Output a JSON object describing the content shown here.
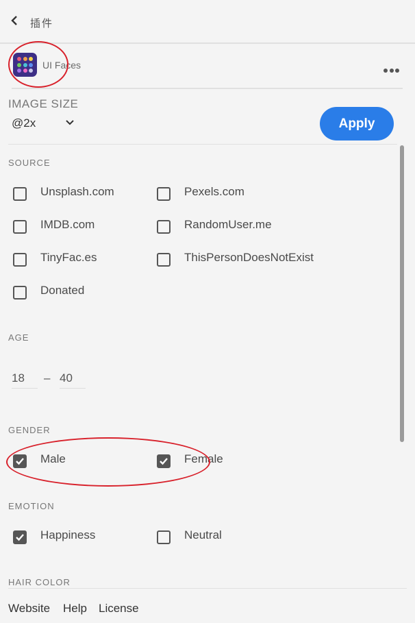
{
  "topbar": {
    "title": "插件"
  },
  "plugin": {
    "name": "UI Faces"
  },
  "image_size": {
    "label": "IMAGE SIZE",
    "selected": "@2x",
    "apply_label": "Apply"
  },
  "source": {
    "label": "SOURCE",
    "options": [
      {
        "label": "Unsplash.com",
        "checked": false
      },
      {
        "label": "Pexels.com",
        "checked": false
      },
      {
        "label": "IMDB.com",
        "checked": false
      },
      {
        "label": "RandomUser.me",
        "checked": false
      },
      {
        "label": "TinyFac.es",
        "checked": false
      },
      {
        "label": "ThisPersonDoesNotExist",
        "checked": false
      },
      {
        "label": "Donated",
        "checked": false
      }
    ]
  },
  "age": {
    "label": "AGE",
    "min": "18",
    "separator": "–",
    "max": "40"
  },
  "gender": {
    "label": "GENDER",
    "options": [
      {
        "label": "Male",
        "checked": true
      },
      {
        "label": "Female",
        "checked": true
      }
    ]
  },
  "emotion": {
    "label": "EMOTION",
    "options": [
      {
        "label": "Happiness",
        "checked": true
      },
      {
        "label": "Neutral",
        "checked": false
      }
    ]
  },
  "hair_color": {
    "label": "HAIR COLOR"
  },
  "footer": {
    "links": [
      "Website",
      "Help",
      "License"
    ]
  },
  "colors": {
    "accent": "#2a7de8",
    "annotation": "#d8212b",
    "icon_bg": "#3d2f86"
  },
  "icons": {
    "back": "chevron-left-icon",
    "more": "more-horizontal-icon",
    "plugin": "ui-faces-app-icon"
  }
}
